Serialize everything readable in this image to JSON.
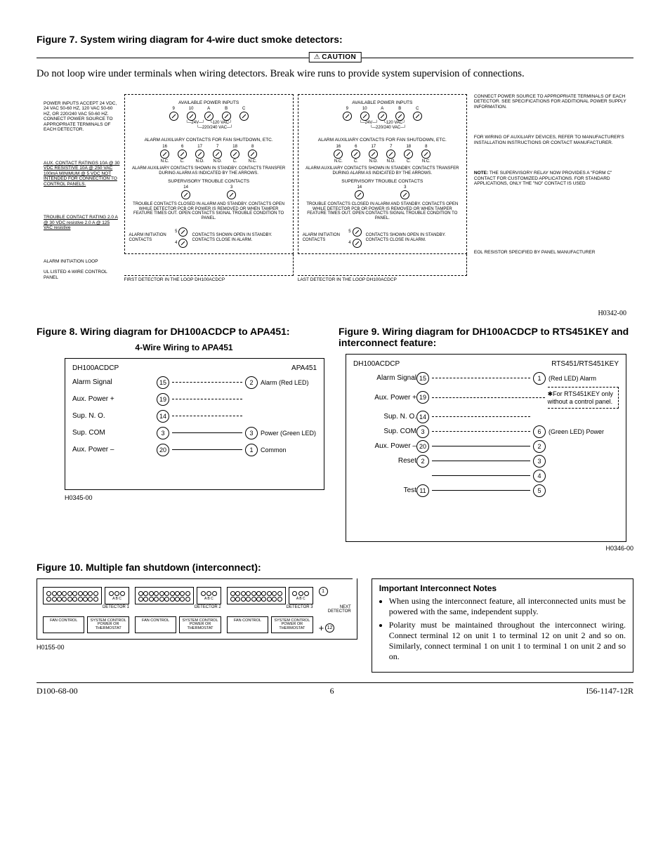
{
  "fig7": {
    "title": "Figure 7. System wiring diagram for 4-wire duct smoke detectors:",
    "caution_label": "CAUTION",
    "caution_text": "Do not loop wire under terminals when wiring detectors. Break wire runs to provide system supervision of connections.",
    "code": "H0342-00",
    "left_notes": {
      "power": "POWER INPUTS ACCEPT 24 VDC, 24 VAC 50-60 HZ, 120 VAC 50-60 HZ, OR 220/240 VAC 50-60 HZ. CONNECT POWER SOURCE TO APPROPRIATE TERMINALS OF EACH DETECTOR.",
      "aux": "AUX. CONTACT RATINGS 10A @ 30 VDC RESISTIVE 10A @ 250 VAC 100mA MINIMUM @ 5 VDC NOT INTENDED FOR CONNECTION TO CONTROL PANELS.",
      "trouble": "TROUBLE CONTACT RATING 2.0 A @ 30 VDC resistive 2.0 A @ 125 VAC resistive",
      "loop": "ALARM INITIATION LOOP",
      "panel": "UL LISTED 4-WIRE CONTROL PANEL"
    },
    "detector": {
      "power_title": "AVAILABLE POWER INPUTS",
      "power_terms": [
        "9",
        "10",
        "A",
        "B",
        "C"
      ],
      "power_sub": [
        [
          "24V",
          ""
        ],
        [
          "",
          "120 VAC"
        ],
        [
          "",
          "",
          "220/240 VAC"
        ]
      ],
      "alarm_title": "ALARM AUXILIARY CONTACTS FOR FAN SHUTDOWN, ETC.",
      "alarm_terms": [
        "16",
        "6",
        "17",
        "7",
        "18",
        "8"
      ],
      "alarm_sub": [
        "N.C.",
        "C.",
        "N.O.",
        "N.O.",
        "C.",
        "N.C."
      ],
      "alarm_note": "ALARM AUXILIARY CONTACTS SHOWN IN STANDBY. CONTACTS TRANSFER DURING ALARM AS INDICATED BY THE ARROWS.",
      "sup_title": "SUPERVISORY TROUBLE CONTACTS",
      "sup_terms": [
        "14",
        "3"
      ],
      "sup_note": "TROUBLE CONTACTS CLOSED IN ALARM AND STANDBY. CONTACTS OPEN WHILE DETECTOR PCB OR POWER IS REMOVED OR WHEN TAMPER FEATURE TIMES OUT. OPEN CONTACTS SIGNAL TROUBLE CONDITION TO PANEL.",
      "init_label": "ALARM INITIATION CONTACTS",
      "init_terms": [
        "5",
        "4"
      ],
      "init_note": "CONTACTS SHOWN OPEN IN STANDBY. CONTACTS CLOSE IN ALARM.",
      "first_footer": "FIRST DETECTOR IN THE LOOP DH100ACDCP",
      "last_footer": "LAST DETECTOR IN THE LOOP DH100ACDCP"
    },
    "right_notes": {
      "connect": "CONNECT POWER SOURCE TO APPROPRIATE TERMINALS OF EACH DETECTOR. SEE SPECIFICATIONS FOR ADDITIONAL POWER SUPPLY INFORMATION.",
      "wiring": "FOR WIRING OF AUXILIARY DEVICES, REFER TO MANUFACTURER'S INSTALLATION INSTRUCTIONS OR CONTACT MANUFACTURER.",
      "note_label": "NOTE:",
      "note": "THE SUPERVISORY RELAY NOW PROVIDES A \"FORM C\" CONTACT FOR CUSTOMIZED APPLICATIONS. FOR STANDARD APPLICATIONS, ONLY THE \"NO\" CONTACT IS USED",
      "eol": "EOL RESISTOR SPECIFIED BY PANEL MANUFACTURER"
    }
  },
  "fig8": {
    "title": "Figure 8. Wiring diagram for DH100ACDCP to APA451:",
    "subtitle": "4-Wire Wiring to APA451",
    "left_head": "DH100ACDCP",
    "right_head": "APA451",
    "rows": [
      {
        "l": "Alarm Signal",
        "ln": "15",
        "rn": "2",
        "r": "Alarm (Red LED)",
        "dash": true
      },
      {
        "l": "Aux. Power +",
        "ln": "19",
        "rn": "",
        "r": "",
        "dash": true
      },
      {
        "l": "Sup. N. O.",
        "ln": "14",
        "rn": "",
        "r": "",
        "dash": true
      },
      {
        "l": "Sup. COM",
        "ln": "3",
        "rn": "3",
        "r": "Power (Green LED)",
        "dash": false
      },
      {
        "l": "Aux. Power –",
        "ln": "20",
        "rn": "1",
        "r": "Common",
        "dash": false
      }
    ],
    "code": "H0345-00"
  },
  "fig9": {
    "title": "Figure 9. Wiring diagram for DH100ACDCP to RTS451KEY and interconnect feature:",
    "left_head": "DH100ACDCP",
    "right_head": "RTS451/RTS451KEY",
    "rts_note": "For RTS451KEY only without a control panel.",
    "rows": [
      {
        "l": "Alarm Signal",
        "ln": "15",
        "rn": "1",
        "r": "(Red LED) Alarm"
      },
      {
        "l": "Aux. Power +",
        "ln": "19",
        "rn": "",
        "r": ""
      },
      {
        "l": "Sup. N. O.",
        "ln": "14",
        "rn": "",
        "r": ""
      },
      {
        "l": "Sup. COM",
        "ln": "3",
        "rn": "6",
        "r": "(Green LED) Power"
      },
      {
        "l": "Aux. Power –",
        "ln": "20",
        "rn": "2",
        "r": ""
      },
      {
        "l": "Reset",
        "ln": "2",
        "rn": "3",
        "r": ""
      },
      {
        "l": "",
        "ln": "",
        "rn": "4",
        "r": ""
      },
      {
        "l": "Test",
        "ln": "11",
        "rn": "5",
        "r": ""
      }
    ],
    "code": "H0346-00"
  },
  "fig10": {
    "title": "Figure 10. Multiple fan shutdown (interconnect):",
    "detectors": [
      "DETECTOR 1",
      "DETECTOR 2",
      "DETECTOR 3"
    ],
    "next": "NEXT DETECTOR",
    "pins": [
      "1",
      "12"
    ],
    "fan_control": "FAN CONTROL",
    "sys_control": "SYSTEM CONTROL POWER OR THERMOSTAT",
    "code": "H0155-00"
  },
  "notes": {
    "title": "Important Interconnect Notes",
    "items": [
      "When using the interconnect feature, all interconnected units must be powered with the same, independent supply.",
      "Polarity must be maintained throughout the interconnect wiring. Connect terminal 12 on unit 1 to terminal 12 on unit 2 and so on. Similarly, connect terminal 1 on unit 1 to terminal 1 on unit 2 and so on."
    ]
  },
  "footer": {
    "left": "D100-68-00",
    "center": "6",
    "right": "I56-1147-12R"
  }
}
